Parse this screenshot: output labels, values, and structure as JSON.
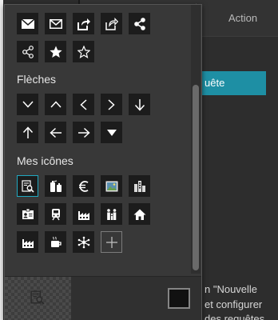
{
  "background": {
    "tab_action": "Action",
    "button_label": "uête",
    "text_lines": [
      "n \"Nouvelle",
      "et configurer",
      "des requêtes"
    ],
    "accent_color": "#1e8fa4"
  },
  "popup": {
    "sections": {
      "arrows_title": "Flèches",
      "my_icons_title": "Mes icônes"
    },
    "top_icons": [
      "envelope-filled-icon",
      "envelope-outline-icon",
      "share-box-filled-icon",
      "share-box-outline-icon",
      "share-network-filled-icon",
      "share-network-outline-icon",
      "star-filled-icon",
      "star-outline-icon"
    ],
    "arrow_icons": [
      "chevron-down-icon",
      "chevron-up-icon",
      "chevron-left-icon",
      "chevron-right-icon",
      "arrow-down-icon",
      "arrow-up-icon",
      "arrow-left-icon",
      "arrow-right-icon",
      "triangle-down-icon"
    ],
    "my_icons": [
      "search-document-icon",
      "fire-extinguisher-icon",
      "euro-icon",
      "picture-icon",
      "buildings-icon",
      "id-card-icon",
      "train-icon",
      "factory-icon",
      "family-icon",
      "home-icon",
      "factory-icon",
      "coffee-cup-icon",
      "network-hub-icon",
      "add-icon"
    ],
    "selected_icon": "search-document-icon",
    "selection_color": "#20a7c0"
  }
}
